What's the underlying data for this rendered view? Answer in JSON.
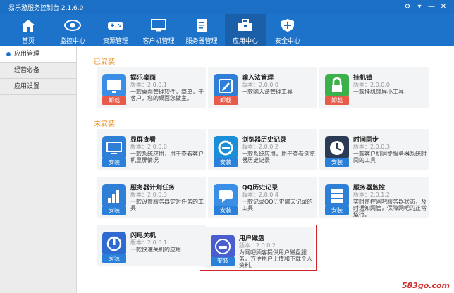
{
  "window": {
    "title": "易乐游服务控制台 2.1.6.0"
  },
  "toolbar": [
    {
      "label": "首页",
      "icon": "home-icon"
    },
    {
      "label": "监控中心",
      "icon": "eye-icon"
    },
    {
      "label": "资源管理",
      "icon": "gamepad-icon"
    },
    {
      "label": "客户机管理",
      "icon": "monitor-icon"
    },
    {
      "label": "服务器管理",
      "icon": "document-icon"
    },
    {
      "label": "应用中心",
      "icon": "toolbox-icon"
    },
    {
      "label": "安全中心",
      "icon": "shield-icon"
    }
  ],
  "sidebar": [
    {
      "label": "应用管理"
    },
    {
      "label": "经营必备"
    },
    {
      "label": "应用设置"
    }
  ],
  "sections": {
    "installed": "已安装",
    "uninstalled": "未安装"
  },
  "buttons": {
    "uninstall": "卸载",
    "install": "安装"
  },
  "version_prefix": "版本：",
  "installed": [
    {
      "name": "娱乐桌面",
      "version": "版本：2.0.0.1",
      "desc": "一款桌面管理软件，简单，于客户，您的桌面您做主。",
      "icon_color": "#3a8ee6"
    },
    {
      "name": "输入法管理",
      "version": "版本：2.0.0.0",
      "desc": "一款输入法管理工具",
      "icon_color": "#2f7fd6"
    },
    {
      "name": "挂机锁",
      "version": "版本：2.0.0.0",
      "desc": "一款挂机锁屏小工具",
      "icon_color": "#3cb04a"
    }
  ],
  "uninstalled": [
    {
      "name": "显屏查看",
      "version": "版本：2.0.0.0",
      "desc": "一款系统应用，用于查看客户机显屏情况",
      "icon_color": "#2f7fd6"
    },
    {
      "name": "浏览器历史记录",
      "version": "版本：2.0.0.2",
      "desc": "一款系统应用，用于查看浏览器历史记录",
      "icon_color": "#1a8fd8"
    },
    {
      "name": "时间同步",
      "version": "版本：2.0.0.3",
      "desc": "一款客户机同步服务器系统时间的工具",
      "icon_color": "#2b3a55"
    },
    {
      "name": "服务器计划任务",
      "version": "版本：2.0.0.3",
      "desc": "一款设置服务器定时任务的工具",
      "icon_color": "#2f7fd6"
    },
    {
      "name": "QQ历史记录",
      "version": "版本：2.0.0.4",
      "desc": "一款记录QQ历史聊天记录的工具",
      "icon_color": "#3a8ee6"
    },
    {
      "name": "服务器监控",
      "version": "版本：2.0.1.2",
      "desc": "实时监控网吧服务器状态，及时通知网管，保障网吧的正常运行。",
      "icon_color": "#2f7fd6"
    },
    {
      "name": "闪电关机",
      "version": "版本：2.0.0.1",
      "desc": "一款快速关机的应用",
      "icon_color": "#2f6ad0"
    },
    {
      "name": "用户磁盘",
      "version": "版本：2.0.0.2",
      "desc": "为网吧顾客提供用户磁盘服务，方便用户上传和下载个人资料。",
      "icon_color": "#4a5fcf"
    }
  ],
  "watermark": "583go.com"
}
